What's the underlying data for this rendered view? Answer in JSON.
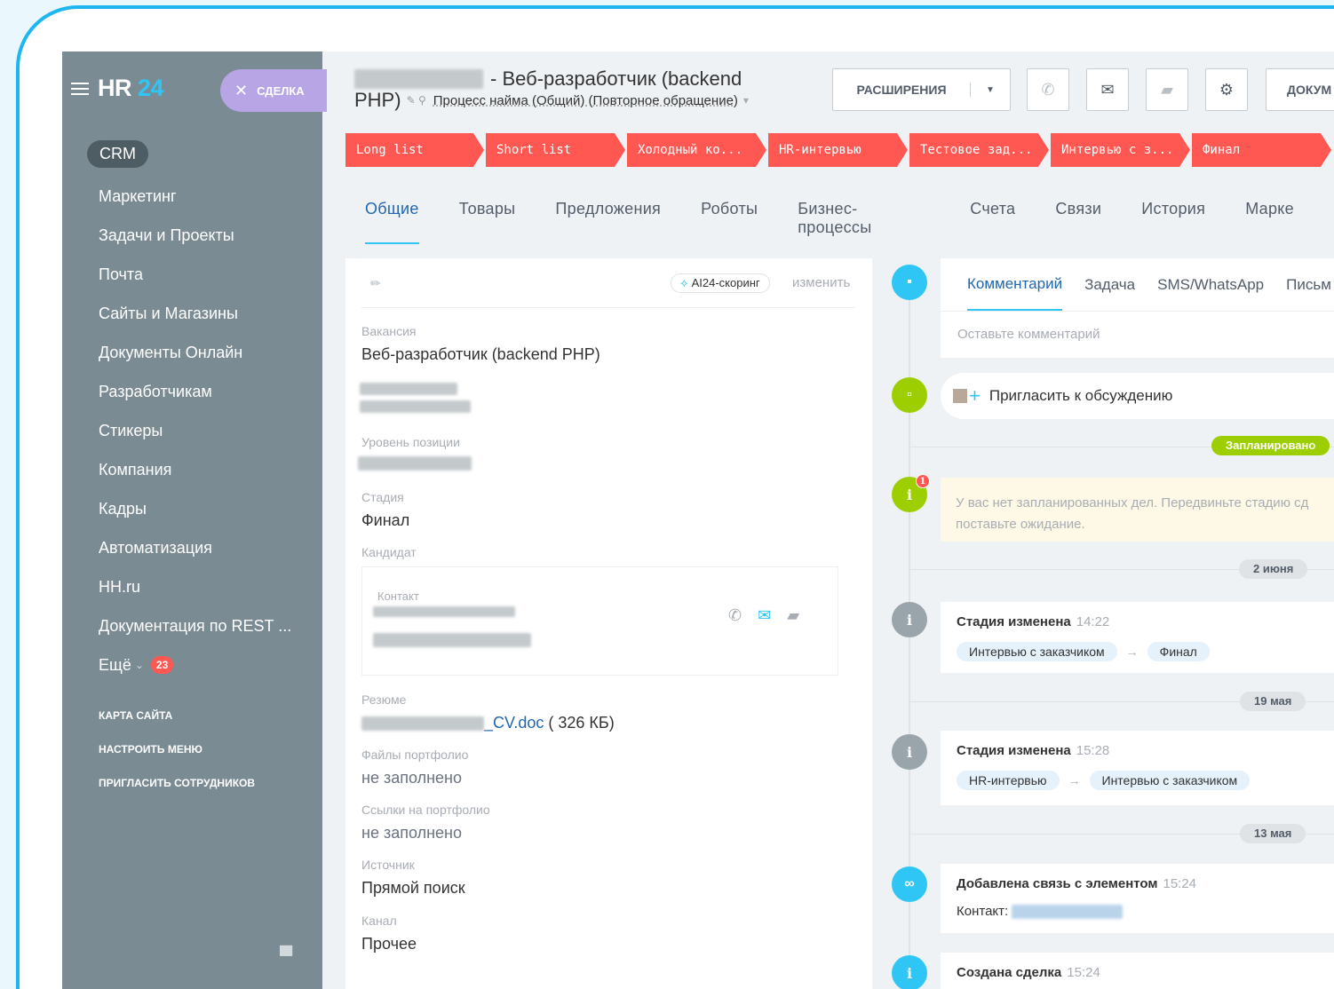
{
  "sidebar": {
    "brand_prefix": "HR",
    "brand_number": "24",
    "deal_label": "СДЕЛКА",
    "crm_label": "CRM",
    "items": [
      "Маркетинг",
      "Задачи и Проекты",
      "Почта",
      "Сайты и Магазины",
      "Документы Онлайн",
      "Разработчикам",
      "Стикеры",
      "Компания",
      "Кадры",
      "Автоматизация",
      "HH.ru",
      "Документация по REST ..."
    ],
    "more_label": "Ещё",
    "more_arrow": "⌄",
    "more_count": "23",
    "small_links": [
      "КАРТА САЙТА",
      "НАСТРОИТЬ МЕНЮ",
      "ПРИГЛАСИТЬ СОТРУДНИКОВ"
    ]
  },
  "header": {
    "title_part": "- Веб-разработчик (backend",
    "title_part2": "PHP)",
    "process": "Процесс найма (Общий) (Повторное обращение)",
    "extensions_label": "РАСШИРЕНИЯ",
    "docs_label": "ДОКУМ"
  },
  "stages": [
    "Long list",
    "Short list",
    "Холодный ко...",
    "HR-интервью",
    "Тестовое зад...",
    "Интервью с з...",
    "Финал"
  ],
  "tabs": [
    "Общие",
    "Товары",
    "Предложения",
    "Роботы",
    "Бизнес-процессы",
    "Счета",
    "Связи",
    "История",
    "Марке"
  ],
  "card": {
    "ai_label": "AI24-скоринг",
    "change_label": "изменить",
    "vacancy_label": "Вакансия",
    "vacancy_value": "Веб-разработчик (backend PHP)",
    "level_label": "Уровень позиции",
    "stage_label": "Стадия",
    "stage_value": "Финал",
    "candidate_label": "Кандидат",
    "contact_label": "Контакт",
    "resume_label": "Резюме",
    "resume_file": "_CV.doc",
    "resume_size": "( 326 КБ)",
    "portfolio_files_label": "Файлы портфолио",
    "portfolio_files_value": "не заполнено",
    "portfolio_links_label": "Ссылки на портфолио",
    "portfolio_links_value": "не заполнено",
    "source_label": "Источник",
    "source_value": "Прямой поиск",
    "channel_label": "Канал",
    "channel_value": "Прочее"
  },
  "timeline": {
    "editor_tabs": [
      "Комментарий",
      "Задача",
      "SMS/WhatsApp",
      "Письм"
    ],
    "comment_placeholder": "Оставьте комментарий",
    "invite_label": "Пригласить к обсуждению",
    "planned_label": "Запланировано",
    "warning_count": "1",
    "warning_line1": "У вас нет запланированных дел. Передвиньте стадию сд",
    "warning_line2": "поставьте ожидание.",
    "date1": "2 июня",
    "date2": "19 мая",
    "date3": "13 мая",
    "event1_title": "Стадия изменена",
    "event1_time": "14:22",
    "event1_from": "Интервью с заказчиком",
    "event1_to": "Финал",
    "event2_title": "Стадия изменена",
    "event2_time": "15:28",
    "event2_from": "HR-интервью",
    "event2_to": "Интервью с заказчиком",
    "event3_title": "Добавлена связь с элементом",
    "event3_time": "15:24",
    "event3_body": "Контакт:",
    "event4_title": "Создана сделка",
    "event4_time": "15:24"
  },
  "colors": {
    "accent": "#2fc6f6",
    "stage_red": "#ff5752",
    "green": "#9dcf00",
    "link": "#2067b0"
  }
}
